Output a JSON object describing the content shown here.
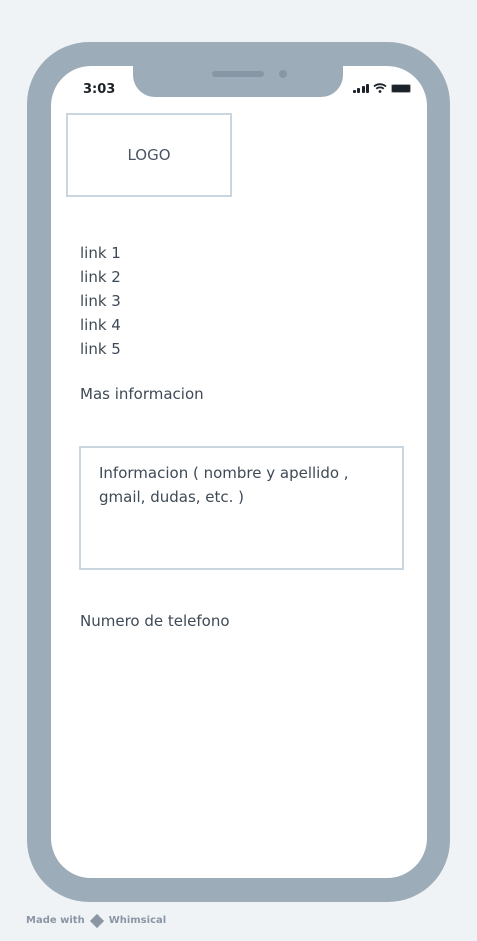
{
  "status_bar": {
    "time": "3:03"
  },
  "logo": {
    "label": "LOGO"
  },
  "nav": {
    "links": [
      "link 1",
      "link 2",
      "link 3",
      "link 4",
      "link 5"
    ]
  },
  "more_info": "Mas informacion",
  "info_box": {
    "text": "Informacion ( nombre y apellido , gmail, dudas, etc. )"
  },
  "phone_label": "Numero de telefono",
  "footer": {
    "made_with": "Made with",
    "brand": "Whimsical"
  }
}
